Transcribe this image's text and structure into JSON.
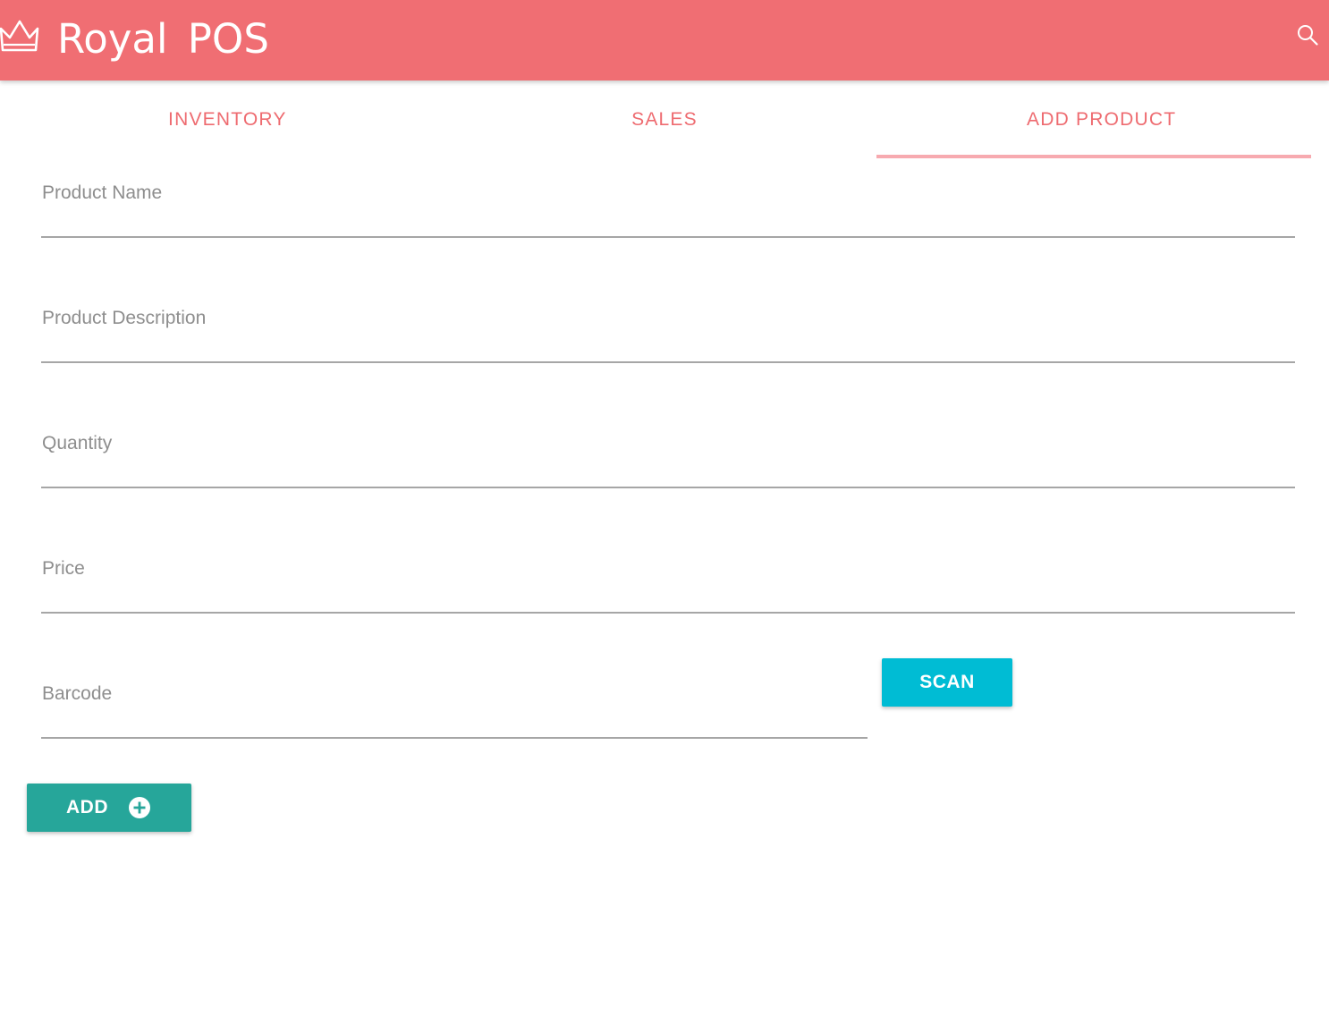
{
  "header": {
    "title": "Royal  POS",
    "logo_icon": "crown-icon",
    "search_icon": "search-icon",
    "background_color": "#f06e73"
  },
  "tabs": [
    {
      "label": "INVENTORY",
      "active": false
    },
    {
      "label": "SALES",
      "active": false
    },
    {
      "label": "ADD PRODUCT",
      "active": true
    }
  ],
  "tab_accent_color": "#ee6b70",
  "form": {
    "product_name": {
      "placeholder": "Product Name",
      "value": ""
    },
    "product_description": {
      "placeholder": "Product Description",
      "value": ""
    },
    "quantity": {
      "placeholder": "Quantity",
      "value": ""
    },
    "price": {
      "placeholder": "Price",
      "value": ""
    },
    "barcode": {
      "placeholder": "Barcode",
      "value": ""
    }
  },
  "buttons": {
    "scan": {
      "label": "SCAN",
      "color": "#00bcd4"
    },
    "add": {
      "label": "ADD",
      "icon": "plus-circle-icon",
      "color": "#26a69a"
    }
  }
}
